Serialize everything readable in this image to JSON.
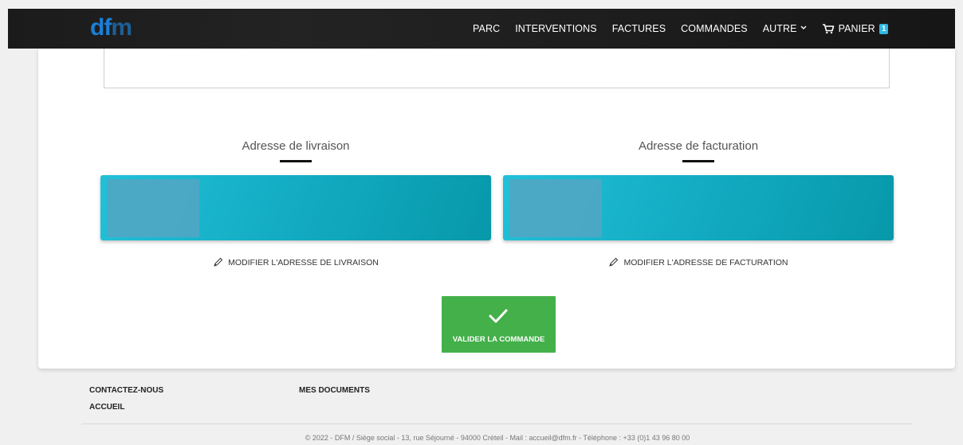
{
  "navbar": {
    "logo": {
      "text_a": "df",
      "text_b": "m"
    },
    "items": [
      {
        "label": "PARC"
      },
      {
        "label": "INTERVENTIONS"
      },
      {
        "label": "FACTURES"
      },
      {
        "label": "COMMANDES"
      },
      {
        "label": "AUTRE"
      }
    ],
    "cart": {
      "label": "PANIER",
      "count": "1"
    }
  },
  "addresses": {
    "delivery": {
      "title": "Adresse de livraison",
      "edit_label": "MODIFIER L'ADRESSE DE LIVRAISON"
    },
    "billing": {
      "title": "Adresse de facturation",
      "edit_label": "MODIFIER L'ADRESSE DE FACTURATION"
    }
  },
  "validate_button": {
    "label": "VALIDER LA COMMANDE"
  },
  "footer": {
    "links": {
      "contact": "CONTACTEZ-NOUS",
      "documents": "MES DOCUMENTS",
      "home": "ACCUEIL"
    },
    "copyright": "© 2022 - DFM / Siège social - 13, rue Séjourné - 94000 Créteil - Mail : accueil@dfm.fr - Téléphone : +33 (0)1 43 96 80 00"
  },
  "colors": {
    "navbar_bg": "#1b1b1b",
    "accent_teal": "#14adc4",
    "validate_green": "#43b049",
    "logo_blue": "#1b7fd6",
    "cart_badge": "#2fb8e0"
  },
  "icons": [
    "pencil-icon",
    "check-icon",
    "cart-icon",
    "chevron-down-icon"
  ]
}
